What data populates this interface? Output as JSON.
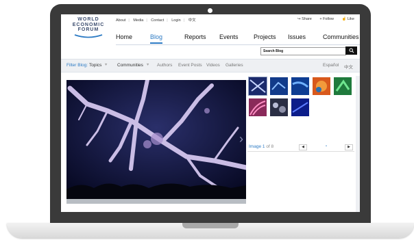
{
  "logo": {
    "line1": "WORLD",
    "line2": "ECONOMIC",
    "line3": "FORUM"
  },
  "utility_links": [
    "About",
    "Media",
    "Contact",
    "Login",
    "中文"
  ],
  "social": {
    "share": "Share",
    "follow": "+ Follow",
    "like": "Like"
  },
  "nav": [
    "Home",
    "Blog",
    "Reports",
    "Events",
    "Projects",
    "Issues",
    "Communities"
  ],
  "nav_active": "Blog",
  "search": {
    "placeholder": "Search Blog",
    "button_icon": "search-icon"
  },
  "filter": {
    "label": "Filter Blog:",
    "topics": "Topics",
    "communities": "Communities",
    "authors": "Authors",
    "event_posts": "Event Posts",
    "videos": "Videos",
    "galleries": "Galleries",
    "lang_es": "Español",
    "lang_zh": "中文"
  },
  "gallery": {
    "image_label": "Image",
    "current": "1",
    "of_text": "of 8"
  },
  "colors": {
    "accent": "#2d7bc4",
    "logo": "#3b4c6e",
    "bezel": "#3a3a3a"
  }
}
